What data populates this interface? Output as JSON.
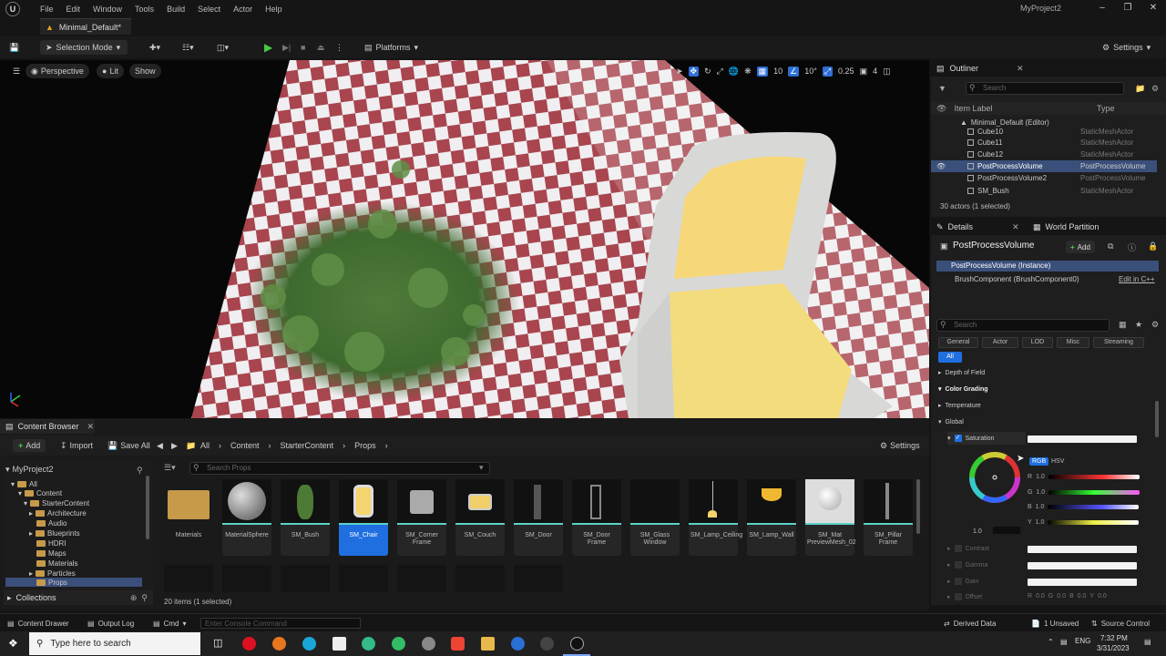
{
  "menubar": {
    "items": [
      "File",
      "Edit",
      "Window",
      "Tools",
      "Build",
      "Select",
      "Actor",
      "Help"
    ],
    "project": "MyProject2"
  },
  "level_tab": "Minimal_Default*",
  "toolbar": {
    "selection_mode": "Selection Mode",
    "platforms": "Platforms",
    "settings": "Settings"
  },
  "viewport": {
    "perspective": "Perspective",
    "lit": "Lit",
    "show": "Show",
    "grid_value": "10",
    "rotation_value": "10°",
    "scale_value": "0.25",
    "camera_speed": "4"
  },
  "outliner": {
    "title": "Outliner",
    "search_placeholder": "Search",
    "col_label": "Item Label",
    "col_type": "Type",
    "root": "Minimal_Default (Editor)",
    "rows": [
      {
        "label": "Cube10",
        "type": "StaticMeshActor"
      },
      {
        "label": "Cube11",
        "type": "StaticMeshActor"
      },
      {
        "label": "Cube12",
        "type": "StaticMeshActor"
      },
      {
        "label": "PostProcessVolume",
        "type": "PostProcessVolume"
      },
      {
        "label": "PostProcessVolume2",
        "type": "PostProcessVolume"
      },
      {
        "label": "SM_Bush",
        "type": "StaticMeshActor"
      }
    ],
    "count": "30 actors (1 selected)"
  },
  "details": {
    "tab_details": "Details",
    "tab_world_partition": "World Partition",
    "object_name": "PostProcessVolume",
    "add_label": "Add",
    "instance_label": "PostProcessVolume (Instance)",
    "component_label": "BrushComponent (BrushComponent0)",
    "edit_in_cpp": "Edit in C++",
    "search_placeholder": "Search",
    "categories": [
      "General",
      "Actor",
      "LOD",
      "Misc",
      "Streaming",
      "All"
    ],
    "sections": {
      "depth_of_field": "Depth of Field",
      "color_grading": "Color Grading",
      "temperature": "Temperature",
      "global": "Global",
      "saturation": "Saturation",
      "contrast": "Contrast",
      "gamma": "Gamma",
      "gain": "Gain",
      "offset": "Offset"
    },
    "color_picker": {
      "rgb": "RGB",
      "hsv": "HSV",
      "r_label": "R",
      "r": "1.0",
      "g_label": "G",
      "g": "1.0",
      "b_label": "B",
      "b": "1.0",
      "y_label": "Y",
      "y": "1.0",
      "wheel_value": "1.0"
    },
    "offset_values": [
      {
        "label": "R",
        "value": "0.0"
      },
      {
        "label": "G",
        "value": "0.0"
      },
      {
        "label": "B",
        "value": "0.0"
      },
      {
        "label": "Y",
        "value": "0.0"
      }
    ]
  },
  "content_browser": {
    "tab": "Content Browser",
    "add": "Add",
    "import": "Import",
    "save_all": "Save All",
    "breadcrumb": [
      "All",
      "Content",
      "StarterContent",
      "Props"
    ],
    "settings": "Settings",
    "search_placeholder": "Search Props",
    "tree_root": "MyProject2",
    "tree": [
      {
        "label": "All",
        "level": 0
      },
      {
        "label": "Content",
        "level": 1
      },
      {
        "label": "StarterContent",
        "level": 2
      },
      {
        "label": "Architecture",
        "level": 3
      },
      {
        "label": "Audio",
        "level": 3
      },
      {
        "label": "Blueprints",
        "level": 3
      },
      {
        "label": "HDRI",
        "level": 3
      },
      {
        "label": "Maps",
        "level": 3
      },
      {
        "label": "Materials",
        "level": 3
      },
      {
        "label": "Particles",
        "level": 3
      },
      {
        "label": "Props",
        "level": 3
      }
    ],
    "assets": [
      "Materials",
      "MaterialSphere",
      "SM_Bush",
      "SM_Chair",
      "SM_Corner Frame",
      "SM_Couch",
      "SM_Door",
      "SM_Door Frame",
      "SM_Glass Window",
      "SM_Lamp_Ceiling",
      "SM_Lamp_Wall",
      "SM_Mat PreviewMesh_02",
      "SM_Pillar Frame"
    ],
    "selected_asset": "SM_Chair",
    "collections": "Collections",
    "item_count": "20 items (1 selected)"
  },
  "statusbar": {
    "content_drawer": "Content Drawer",
    "output_log": "Output Log",
    "cmd": "Cmd",
    "console_placeholder": "Enter Console Command",
    "derived_data": "Derived Data",
    "unsaved": "1 Unsaved",
    "source_control": "Source Control"
  },
  "taskbar": {
    "search_placeholder": "Type here to search",
    "lang": "ENG",
    "time": "7:32 PM",
    "date": "3/31/2023"
  },
  "colors": {
    "accent": "#1f6fe0",
    "selection_row": "#3a4f7a",
    "play_green": "#44cc44",
    "folder": "#c79a4a"
  }
}
